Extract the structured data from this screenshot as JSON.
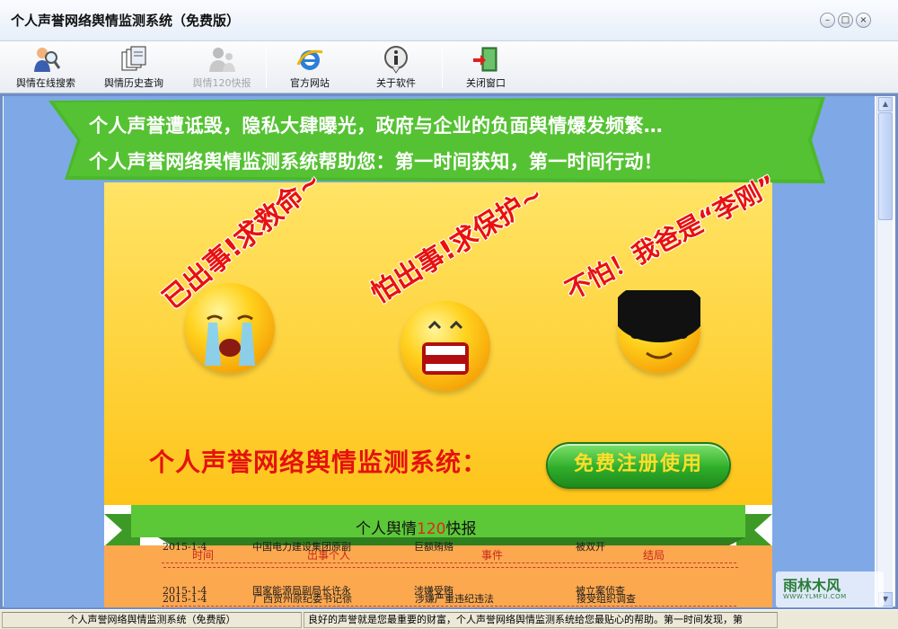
{
  "window": {
    "title": "个人声誉网络舆情监测系统（免费版）",
    "controls": [
      "minimize",
      "maximize",
      "close"
    ]
  },
  "toolbar": {
    "buttons": [
      {
        "label": "舆情在线搜索",
        "icon": "person-magnifier-icon",
        "enabled": true
      },
      {
        "label": "舆情历史查询",
        "icon": "documents-icon",
        "enabled": true
      },
      {
        "label": "舆情120快报",
        "icon": "people-icon",
        "enabled": false
      },
      {
        "label": "官方网站",
        "icon": "internet-explorer-icon",
        "enabled": true
      },
      {
        "label": "关于软件",
        "icon": "info-icon",
        "enabled": true
      },
      {
        "label": "关闭窗口",
        "icon": "exit-door-icon",
        "enabled": true
      }
    ]
  },
  "banner": {
    "line1": "个人声誉遭诋毁，隐私大肆曝光，政府与企业的负面舆情爆发频繁…",
    "line2": "个人声誉网络舆情监测系统帮助您：第一时间获知，第一时间行动！"
  },
  "faces": {
    "left_text": "已出事!求救命~",
    "middle_text": "怕出事!求保护~",
    "right_text": "不怕！我爸是“李刚”"
  },
  "slogan": "个人声誉网络舆情监测系统：",
  "register_button": "免费注册使用",
  "express": {
    "title_prefix": "个人舆情",
    "title_number": "120",
    "title_suffix": "快报",
    "columns": [
      "时间",
      "出事个人",
      "事件",
      "结局"
    ],
    "rows": [
      {
        "date": "2015-1-4",
        "person": "广西贺州原纪委书记徐",
        "event": "涉嫌严重违纪违法",
        "outcome": "接受组织调查"
      },
      {
        "date": "2015-1-4",
        "person": "中国电力建设集团原副",
        "event": "巨额贿赂",
        "outcome": "被双开"
      },
      {
        "date": "2015-1-4",
        "person": "国家能源局副局长许永",
        "event": "涉嫌受贿",
        "outcome": "被立案侦查"
      }
    ]
  },
  "watermark": {
    "line1": "雨林木风",
    "line2": "WWW.YLMFU.COM"
  },
  "statusbar": {
    "left": "个人声誉网络舆情监测系统（免费版）",
    "right": "良好的声誉就是您最重要的财富，个人声誉网络舆情监测系统给您最贴心的帮助。第一时间发现，第"
  },
  "colors": {
    "accent_green": "#4bb82b",
    "slogan_red": "#e5120d",
    "banner_bg": "#fec419",
    "page_bg": "#7fa8e6"
  }
}
